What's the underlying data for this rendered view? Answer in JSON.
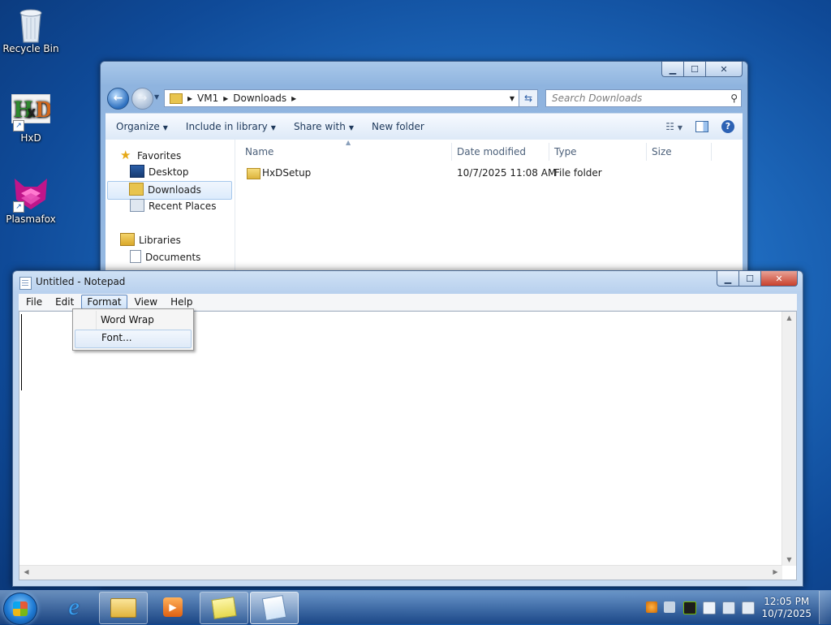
{
  "desktop": {
    "icons": [
      {
        "label": "Recycle Bin"
      },
      {
        "label": "HxD"
      },
      {
        "label": "Plasmafox"
      }
    ]
  },
  "explorer": {
    "breadcrumb": [
      "VM1",
      "Downloads"
    ],
    "search_placeholder": "Search Downloads",
    "toolbar": {
      "organize": "Organize",
      "include_in_library": "Include in library",
      "share_with": "Share with",
      "new_folder": "New folder"
    },
    "nav": {
      "favorites": "Favorites",
      "desktop": "Desktop",
      "downloads": "Downloads",
      "recent_places": "Recent Places",
      "libraries": "Libraries",
      "documents": "Documents"
    },
    "columns": {
      "name": "Name",
      "date_modified": "Date modified",
      "type": "Type",
      "size": "Size"
    },
    "files": [
      {
        "name": "HxDSetup",
        "date_modified": "10/7/2025 11:08 AM",
        "type": "File folder",
        "size": ""
      }
    ]
  },
  "notepad": {
    "title": "Untitled - Notepad",
    "menu": {
      "file": "File",
      "edit": "Edit",
      "format": "Format",
      "view": "View",
      "help": "Help"
    },
    "format_menu": {
      "word_wrap": "Word Wrap",
      "font": "Font..."
    },
    "content": ""
  },
  "taskbar": {
    "clock_time": "12:05 PM",
    "clock_date": "10/7/2025"
  },
  "colors": {
    "desktop_blue": "#1f6cc0",
    "selection_blue": "#dcebfc",
    "title_glass": "#b9d1ee"
  }
}
